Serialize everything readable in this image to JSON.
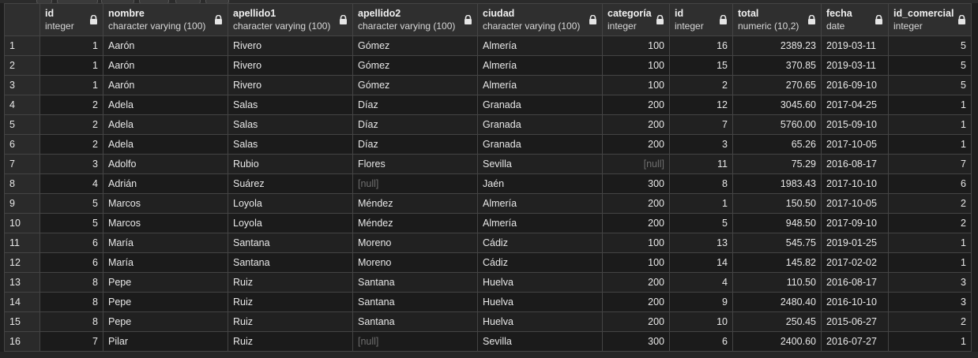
{
  "columns": [
    {
      "name": "",
      "type": ""
    },
    {
      "name": "id",
      "type": "integer"
    },
    {
      "name": "nombre",
      "type": "character varying (100)"
    },
    {
      "name": "apellido1",
      "type": "character varying (100)"
    },
    {
      "name": "apellido2",
      "type": "character varying (100)"
    },
    {
      "name": "ciudad",
      "type": "character varying (100)"
    },
    {
      "name": "categoría",
      "type": "integer"
    },
    {
      "name": "id",
      "type": "integer"
    },
    {
      "name": "total",
      "type": "numeric (10,2)"
    },
    {
      "name": "fecha",
      "type": "date"
    },
    {
      "name": "id_comercial",
      "type": "integer"
    }
  ],
  "null_label": "[null]",
  "rows": [
    [
      "1",
      "1",
      "Aarón",
      "Rivero",
      "Gómez",
      "Almería",
      "100",
      "16",
      "2389.23",
      "2019-03-11",
      "5"
    ],
    [
      "2",
      "1",
      "Aarón",
      "Rivero",
      "Gómez",
      "Almería",
      "100",
      "15",
      "370.85",
      "2019-03-11",
      "5"
    ],
    [
      "3",
      "1",
      "Aarón",
      "Rivero",
      "Gómez",
      "Almería",
      "100",
      "2",
      "270.65",
      "2016-09-10",
      "5"
    ],
    [
      "4",
      "2",
      "Adela",
      "Salas",
      "Díaz",
      "Granada",
      "200",
      "12",
      "3045.60",
      "2017-04-25",
      "1"
    ],
    [
      "5",
      "2",
      "Adela",
      "Salas",
      "Díaz",
      "Granada",
      "200",
      "7",
      "5760.00",
      "2015-09-10",
      "1"
    ],
    [
      "6",
      "2",
      "Adela",
      "Salas",
      "Díaz",
      "Granada",
      "200",
      "3",
      "65.26",
      "2017-10-05",
      "1"
    ],
    [
      "7",
      "3",
      "Adolfo",
      "Rubio",
      "Flores",
      "Sevilla",
      null,
      "11",
      "75.29",
      "2016-08-17",
      "7"
    ],
    [
      "8",
      "4",
      "Adrián",
      "Suárez",
      null,
      "Jaén",
      "300",
      "8",
      "1983.43",
      "2017-10-10",
      "6"
    ],
    [
      "9",
      "5",
      "Marcos",
      "Loyola",
      "Méndez",
      "Almería",
      "200",
      "1",
      "150.50",
      "2017-10-05",
      "2"
    ],
    [
      "10",
      "5",
      "Marcos",
      "Loyola",
      "Méndez",
      "Almería",
      "200",
      "5",
      "948.50",
      "2017-09-10",
      "2"
    ],
    [
      "11",
      "6",
      "María",
      "Santana",
      "Moreno",
      "Cádiz",
      "100",
      "13",
      "545.75",
      "2019-01-25",
      "1"
    ],
    [
      "12",
      "6",
      "María",
      "Santana",
      "Moreno",
      "Cádiz",
      "100",
      "14",
      "145.82",
      "2017-02-02",
      "1"
    ],
    [
      "13",
      "8",
      "Pepe",
      "Ruiz",
      "Santana",
      "Huelva",
      "200",
      "4",
      "110.50",
      "2016-08-17",
      "3"
    ],
    [
      "14",
      "8",
      "Pepe",
      "Ruiz",
      "Santana",
      "Huelva",
      "200",
      "9",
      "2480.40",
      "2016-10-10",
      "3"
    ],
    [
      "15",
      "8",
      "Pepe",
      "Ruiz",
      "Santana",
      "Huelva",
      "200",
      "10",
      "250.45",
      "2015-06-27",
      "2"
    ],
    [
      "16",
      "7",
      "Pilar",
      "Ruiz",
      null,
      "Sevilla",
      "300",
      "6",
      "2400.60",
      "2016-07-27",
      "1"
    ]
  ],
  "colors": {
    "background": "#1e1e1e",
    "header": "#2f2f2f",
    "grid_line": "#444444",
    "null_text": "#6e6e6e"
  }
}
